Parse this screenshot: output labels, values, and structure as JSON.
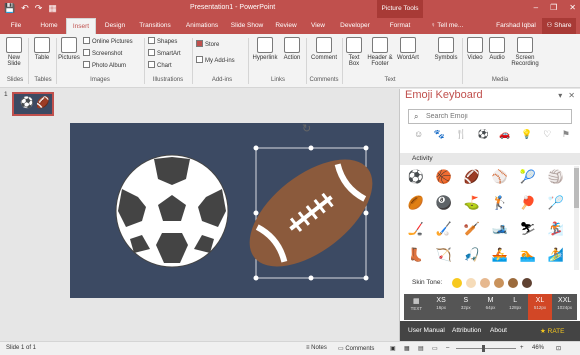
{
  "qat": {
    "save": "💾",
    "undo": "↶",
    "redo": "↷",
    "slideshow": "▦"
  },
  "title": {
    "text": "Presentation1 - PowerPoint",
    "context": "Picture Tools",
    "minimize": "–",
    "restore": "❐",
    "close": "✕"
  },
  "tabs": [
    "File",
    "Home",
    "Insert",
    "Design",
    "Transitions",
    "Animations",
    "Slide Show",
    "Review",
    "View",
    "Developer",
    "Format"
  ],
  "tell_me": "Tell me...",
  "user": "Farshad Iqbal",
  "share": "Share",
  "ribbon": {
    "new_slide": "New Slide",
    "table": "Table",
    "pictures": "Pictures",
    "online_pictures": "Online Pictures",
    "screenshot": "Screenshot",
    "photo_album": "Photo Album",
    "shapes": "Shapes",
    "smartart": "SmartArt",
    "chart": "Chart",
    "store": "Store",
    "my_addins": "My Add-ins",
    "hyperlink": "Hyperlink",
    "action": "Action",
    "comment": "Comment",
    "text_box": "Text Box",
    "header_footer": "Header & Footer",
    "wordart": "WordArt",
    "symbols": "Symbols",
    "video": "Video",
    "audio": "Audio",
    "screen_recording": "Screen Recording",
    "groups": [
      "Slides",
      "Tables",
      "Images",
      "Illustrations",
      "Add-ins",
      "Links",
      "Comments",
      "Text",
      "Media"
    ]
  },
  "thumbnail": {
    "number": "1"
  },
  "pane": {
    "title": "Emoji Keyboard",
    "search_placeholder": "Search Emoji",
    "category_icons": [
      "☺",
      "🐾",
      "🍴",
      "⚽",
      "🚗",
      "💡",
      "♡",
      "⚑"
    ],
    "section": "Activity",
    "emojis": [
      "⚽",
      "🏀",
      "🏈",
      "⚾",
      "🎾",
      "🏐",
      "🏉",
      "🎱",
      "⛳",
      "🏌",
      "🏓",
      "🏸",
      "🏒",
      "🏑",
      "🏏",
      "🎿",
      "⛷",
      "🏂",
      "👢",
      "🏹",
      "🎣",
      "🚣",
      "🏊",
      "🏄"
    ],
    "skin_tone_label": "Skin Tone:",
    "skin_tones": [
      "#f7c91e",
      "#f6dcb9",
      "#e6b88f",
      "#c9925b",
      "#9b6a3b",
      "#5f4131"
    ],
    "sizes": [
      {
        "label": "TEXT",
        "px": ""
      },
      {
        "label": "XS",
        "px": "16px"
      },
      {
        "label": "S",
        "px": "32px"
      },
      {
        "label": "M",
        "px": "64px"
      },
      {
        "label": "L",
        "px": "128px"
      },
      {
        "label": "XL",
        "px": "512px"
      },
      {
        "label": "XXL",
        "px": "1024px"
      }
    ],
    "footer": {
      "manual": "User Manual",
      "attribution": "Attribution",
      "about": "About",
      "rate": "★ RATE"
    }
  },
  "status": {
    "slide": "Slide 1 of 1",
    "notes": "Notes",
    "comments": "Comments",
    "zoom": "46%"
  }
}
